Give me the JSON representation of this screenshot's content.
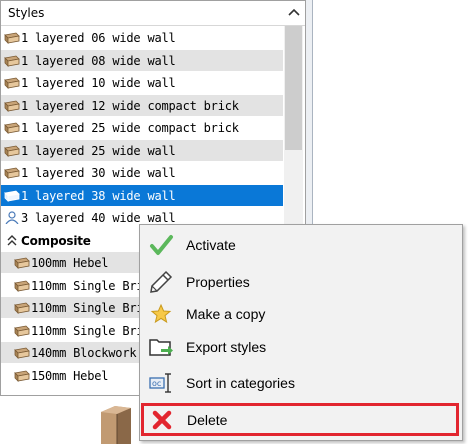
{
  "panel": {
    "title": "Styles"
  },
  "rows": [
    {
      "label": "1 layered 06 wide wall",
      "shade": false
    },
    {
      "label": "1 layered 08 wide wall",
      "shade": true
    },
    {
      "label": "1 layered 10 wide wall",
      "shade": false
    },
    {
      "label": "1 layered 12 wide compact brick",
      "shade": true
    },
    {
      "label": "1 layered 25 wide compact brick",
      "shade": false
    },
    {
      "label": "1 layered 25 wide wall",
      "shade": true
    },
    {
      "label": "1 layered 30 wide wall",
      "shade": false
    },
    {
      "label": "1 layered 38 wide wall",
      "selected": true
    },
    {
      "label": "3 layered 40 wide wall",
      "shade": false,
      "icon": "person-icon"
    }
  ],
  "category": {
    "label": "Composite"
  },
  "composite_rows": [
    {
      "label": "100mm Hebel",
      "shade": true
    },
    {
      "label": "110mm Single  Bric",
      "shade": false
    },
    {
      "label": "110mm Single  Bric",
      "shade": true
    },
    {
      "label": "110mm Single  Bric",
      "shade": false
    },
    {
      "label": "140mm Blockwork",
      "shade": true
    },
    {
      "label": "150mm Hebel",
      "shade": false
    }
  ],
  "menu": {
    "activate": "Activate",
    "properties": "Properties",
    "copy": "Make a copy",
    "export": "Export styles",
    "sort": "Sort in categories",
    "delete": "Delete"
  },
  "colors": {
    "selection": "#0a78d7",
    "row_shade": "#e3e3e3",
    "delete_highlight": "#e2262f",
    "check_green": "#5cb85c"
  }
}
